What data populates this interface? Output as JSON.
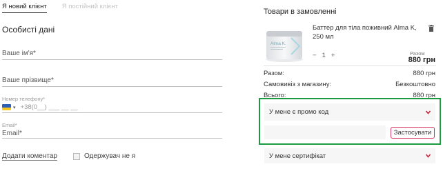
{
  "tabs": {
    "new_client": "Я новий клієнт",
    "regular_client": "Я постійний клієнт"
  },
  "personal": {
    "title": "Особисті дані",
    "name_placeholder": "Ваше ім'я*",
    "surname_placeholder": "Ваше прізвище*",
    "phone_label": "Номер телефону*",
    "phone_mask": "+38(0__) ___ __ __",
    "email_label": "Email*",
    "email_placeholder": "Email*"
  },
  "footer": {
    "add_comment": "Додати коментар",
    "other_recipient": "Одержувач не я"
  },
  "order": {
    "title": "Товари в замовленні",
    "product": {
      "name": "Баттер для тіла поживний Alma K, 250 мл",
      "image_brand": "Alma K.",
      "quantity": "1",
      "price_label": "Разом",
      "price": "880 грн"
    },
    "summary": [
      {
        "label": "Разом:",
        "value": "880 грн"
      },
      {
        "label": "Самовивіз з магазину:",
        "value": "Безкоштовно"
      },
      {
        "label": "Всього:",
        "value": "880 грн"
      }
    ],
    "promo": {
      "label": "У мене є промо код",
      "apply": "Застосувати"
    },
    "certificate": {
      "label": "У мене сертифікат"
    }
  },
  "colors": {
    "accent": "#d4355e",
    "highlight_border": "#1a9a41",
    "flag_blue": "#2b5fb8",
    "flag_yellow": "#f4c81f"
  },
  "icons": [
    "trash-icon",
    "chevron-down-icon",
    "ukraine-flag-icon"
  ]
}
